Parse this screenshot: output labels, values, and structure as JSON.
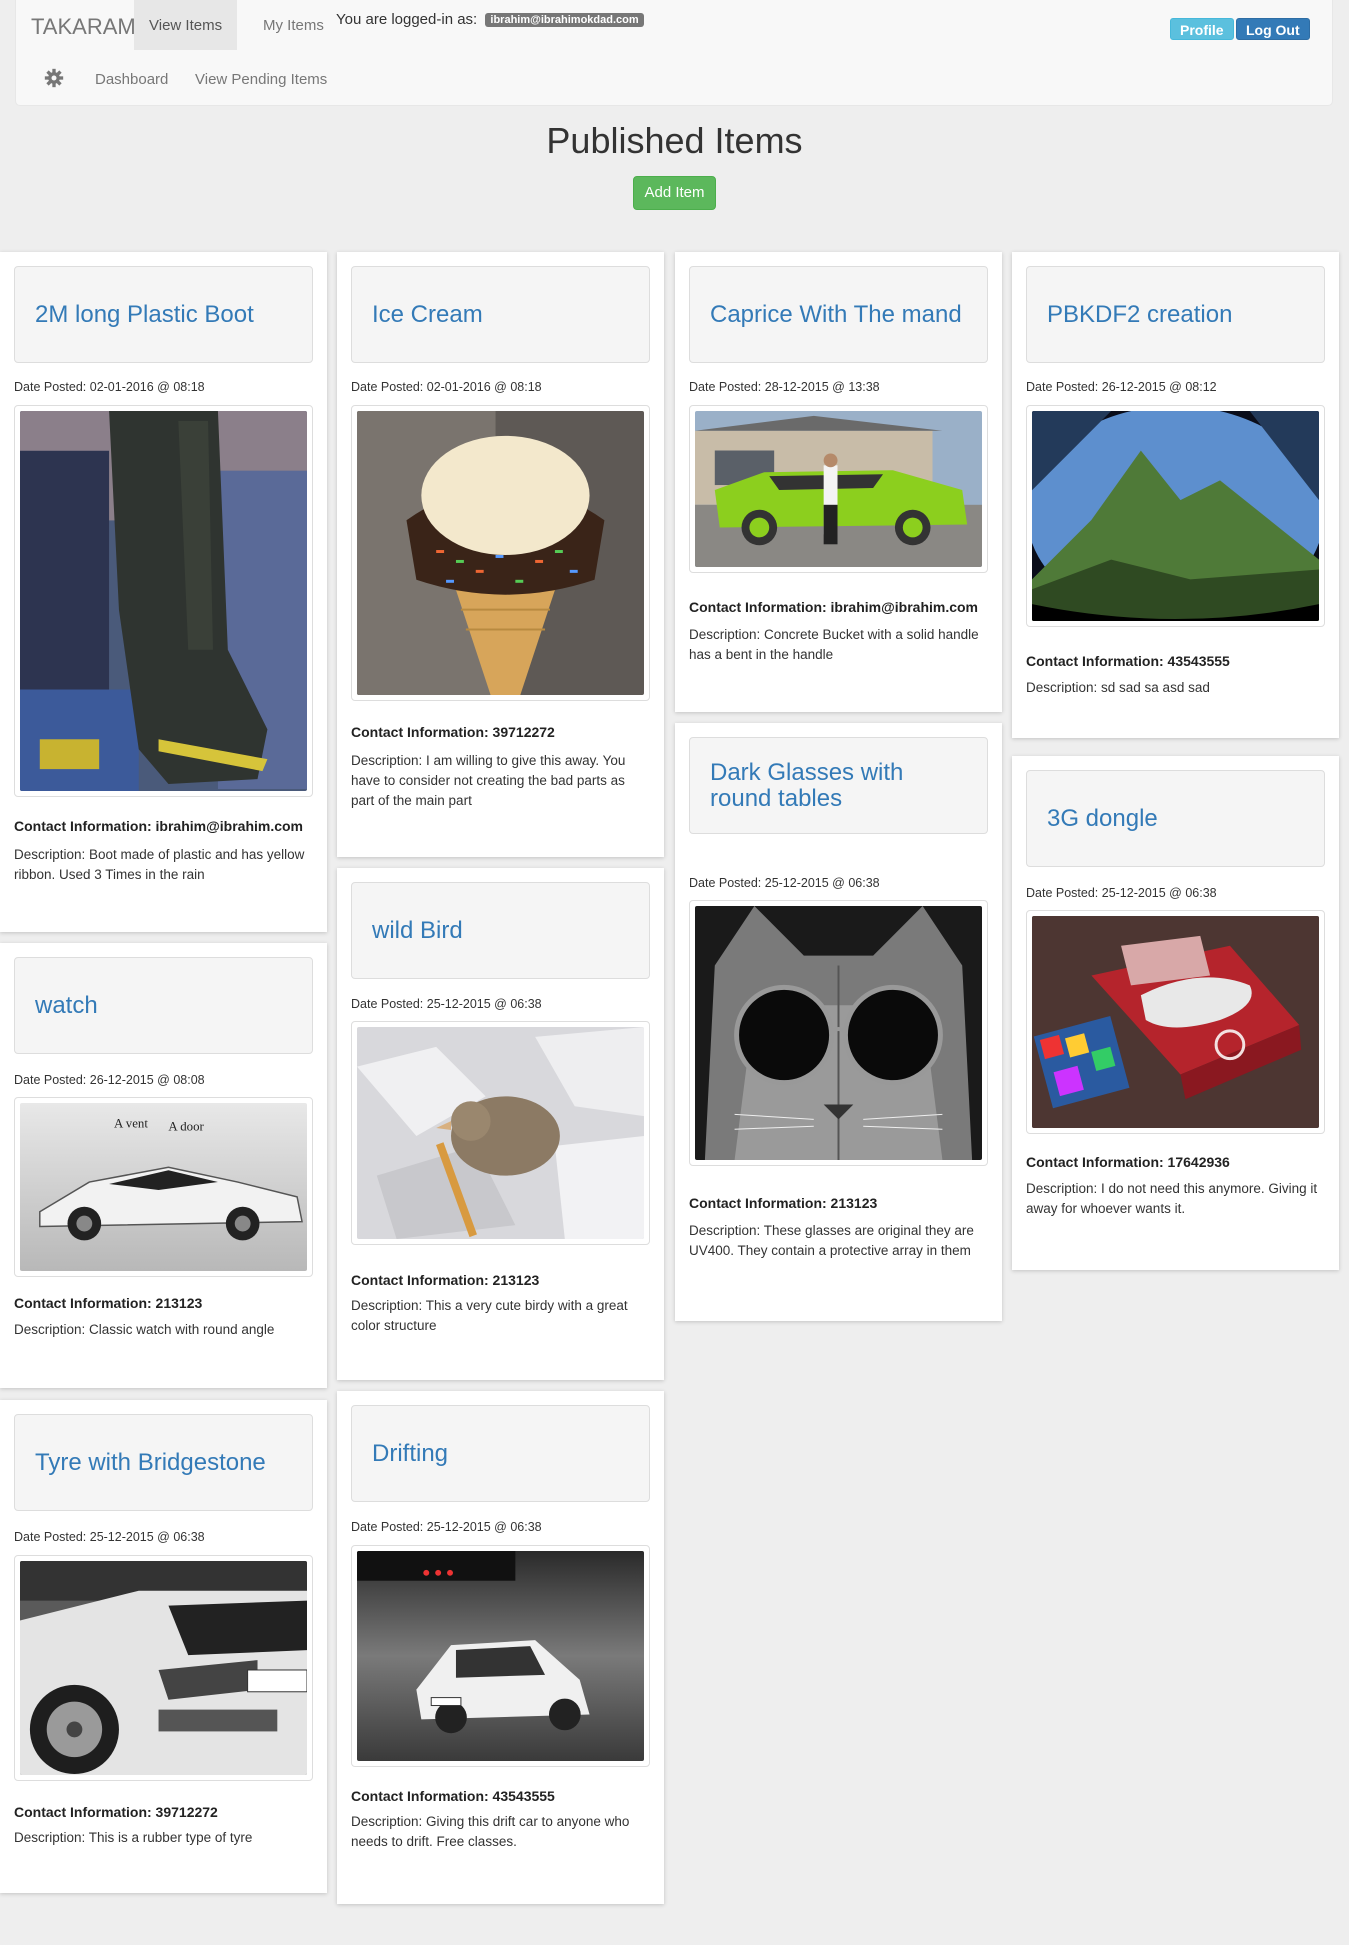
{
  "nav": {
    "brand": "TAKARAM",
    "tabs": [
      {
        "label": "View Items"
      },
      {
        "label": "My Items"
      }
    ],
    "logged_in_text": "You are logged-in as:",
    "email": "ibrahim@ibrahimokdad.com",
    "profile_label": "Profile",
    "logout_label": "Log Out",
    "sub_links": [
      {
        "label": "Dashboard"
      },
      {
        "label": "View Pending Items"
      }
    ]
  },
  "page": {
    "title": "Published Items",
    "add_button": "Add Item"
  },
  "items": [
    {
      "title": "2M long Plastic Boot",
      "date": "Date Posted: 02-01-2016 @ 08:18",
      "contact": "Contact Information: ibrahim@ibrahim.com",
      "description": "Description: Boot made of plastic and has yellow ribbon. Used 3 Times in the rain",
      "image": "boot-photo"
    },
    {
      "title": "Ice Cream",
      "date": "Date Posted: 02-01-2016 @ 08:18",
      "contact": "Contact Information: 39712272",
      "description": "Description: I am willing to give this away. You have to consider not creating the bad parts as part of the main part",
      "image": "ice-cream-photo"
    },
    {
      "title": "Caprice With The mand",
      "date": "Date Posted: 28-12-2015 @ 13:38",
      "contact": "Contact Information: ibrahim@ibrahim.com",
      "description": "Description: Concrete Bucket with a solid handle has a bent in the handle",
      "image": "green-car-photo"
    },
    {
      "title": "PBKDF2 creation",
      "date": "Date Posted: 26-12-2015 @ 08:12",
      "contact": "Contact Information: 43543555",
      "description": "Description: sd sad sa asd sad",
      "image": "mountain-photo"
    },
    {
      "title": "watch",
      "date": "Date Posted: 26-12-2015 @ 08:08",
      "contact": "Contact Information: 213123",
      "description": "Description: Classic watch with round angle",
      "image": "sports-car-photo"
    },
    {
      "title": "wild Bird",
      "date": "Date Posted: 25-12-2015 @ 06:38",
      "contact": "Contact Information: 213123",
      "description": "Description: This a very cute birdy with a great color structure",
      "image": "bird-photo"
    },
    {
      "title": "Dark Glasses with round tables",
      "date": "Date Posted: 25-12-2015 @ 06:38",
      "contact": "Contact Information: 213123",
      "description": "Description: These glasses are original they are UV400. They contain a protective array in them",
      "image": "cat-glasses-photo"
    },
    {
      "title": "3G dongle",
      "date": "Date Posted: 25-12-2015 @ 06:38",
      "contact": "Contact Information: 17642936",
      "description": "Description: I do not need this anymore. Giving it away for whoever wants it.",
      "image": "dongle-photo"
    },
    {
      "title": "Tyre with Bridgestone",
      "date": "Date Posted: 25-12-2015 @ 06:38",
      "contact": "Contact Information: 39712272",
      "description": "Description: This is a rubber type of tyre",
      "image": "white-car-photo"
    },
    {
      "title": "Drifting",
      "date": "Date Posted: 25-12-2015 @ 06:38",
      "contact": "Contact Information: 43543555",
      "description": "Description: Giving this drift car to anyone who needs to drift. Free classes.",
      "image": "drift-car-photo"
    }
  ],
  "colors": {
    "link": "#337ab7",
    "success": "#5cb85c",
    "info": "#5bc0de",
    "primary": "#337ab7",
    "background": "#eeeeee"
  }
}
